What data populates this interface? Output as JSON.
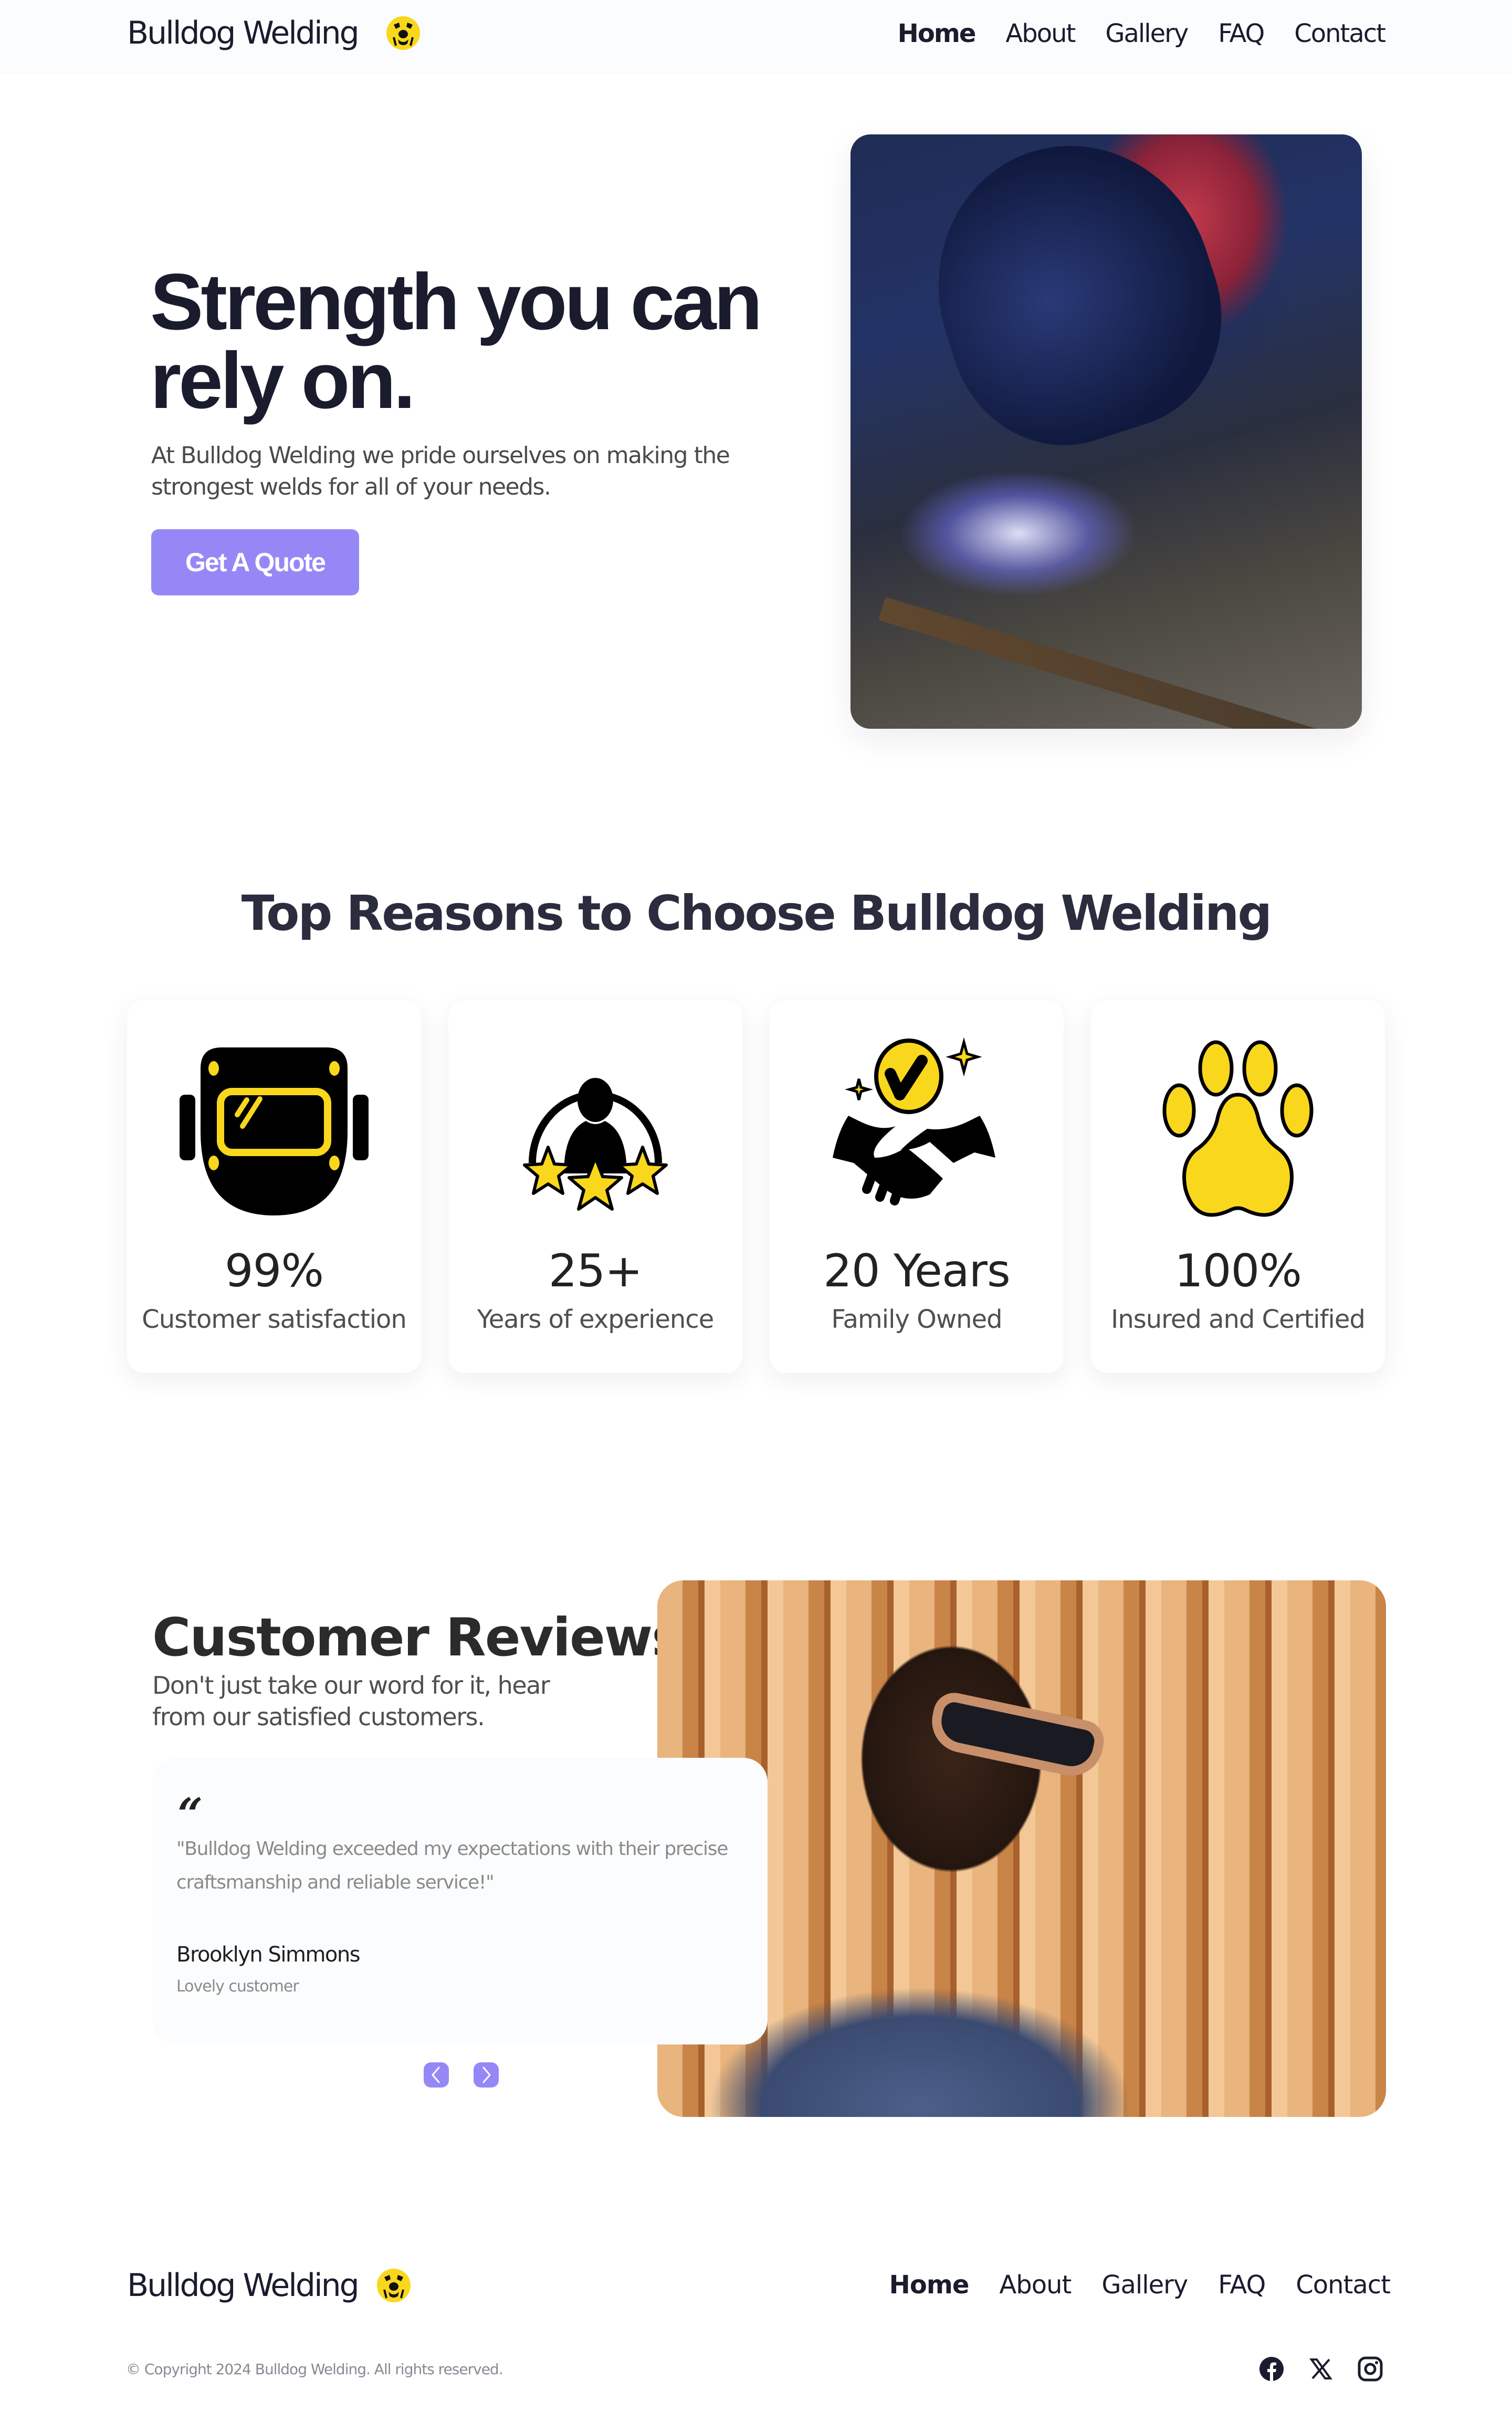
{
  "nav": {
    "brand": "Bulldog Welding",
    "logo_icon": "bulldog-face-icon",
    "links": [
      {
        "label": "Home",
        "active": true
      },
      {
        "label": "About",
        "active": false
      },
      {
        "label": "Gallery",
        "active": false
      },
      {
        "label": "FAQ",
        "active": false
      },
      {
        "label": "Contact",
        "active": false
      }
    ]
  },
  "hero": {
    "title": "Strength you can rely on.",
    "subtitle": "At Bulldog Welding we pride ourselves on making the strongest welds for all of your needs.",
    "cta_label": "Get A Quote",
    "image_alt": "Welder in helmet welding a steel bar with sparks"
  },
  "reasons": {
    "title": "Top Reasons to Choose Bulldog Welding",
    "cards": [
      {
        "icon": "welding-mask-icon",
        "value": "99%",
        "label": "Customer satisfaction"
      },
      {
        "icon": "person-stars-icon",
        "value": "25+",
        "label": "Years of experience"
      },
      {
        "icon": "handshake-check-icon",
        "value": "20 Years",
        "label": "Family Owned"
      },
      {
        "icon": "paw-print-icon",
        "value": "100%",
        "label": "Insured and Certified"
      }
    ]
  },
  "reviews": {
    "title": "Customer Reviews",
    "subtitle": "Don't just take our word for it, hear from our satisfied customers.",
    "quote_icon": "quote-mark-icon",
    "items": [
      {
        "text": "\"Bulldog Welding exceeded my expectations with their precise craftsmanship and reliable service!\"",
        "name": "Brooklyn Simmons",
        "role": "Lovely customer"
      }
    ],
    "prev_icon": "chevron-left-icon",
    "next_icon": "chevron-right-icon",
    "image_alt": "Man in sunglasses leaning against wooden slat wall"
  },
  "footer": {
    "brand": "Bulldog Welding",
    "links": [
      {
        "label": "Home",
        "active": true
      },
      {
        "label": "About",
        "active": false
      },
      {
        "label": "Gallery",
        "active": false
      },
      {
        "label": "FAQ",
        "active": false
      },
      {
        "label": "Contact",
        "active": false
      }
    ],
    "copyright": "© Copyright 2024 Bulldog Welding. All rights reserved.",
    "socials": [
      "facebook-icon",
      "x-icon",
      "instagram-icon"
    ]
  },
  "colors": {
    "accent": "#9588f6",
    "brand_yellow": "#f9d71c",
    "text_dark": "#1a1c2e",
    "nav_bg": "#fbfcfe"
  }
}
